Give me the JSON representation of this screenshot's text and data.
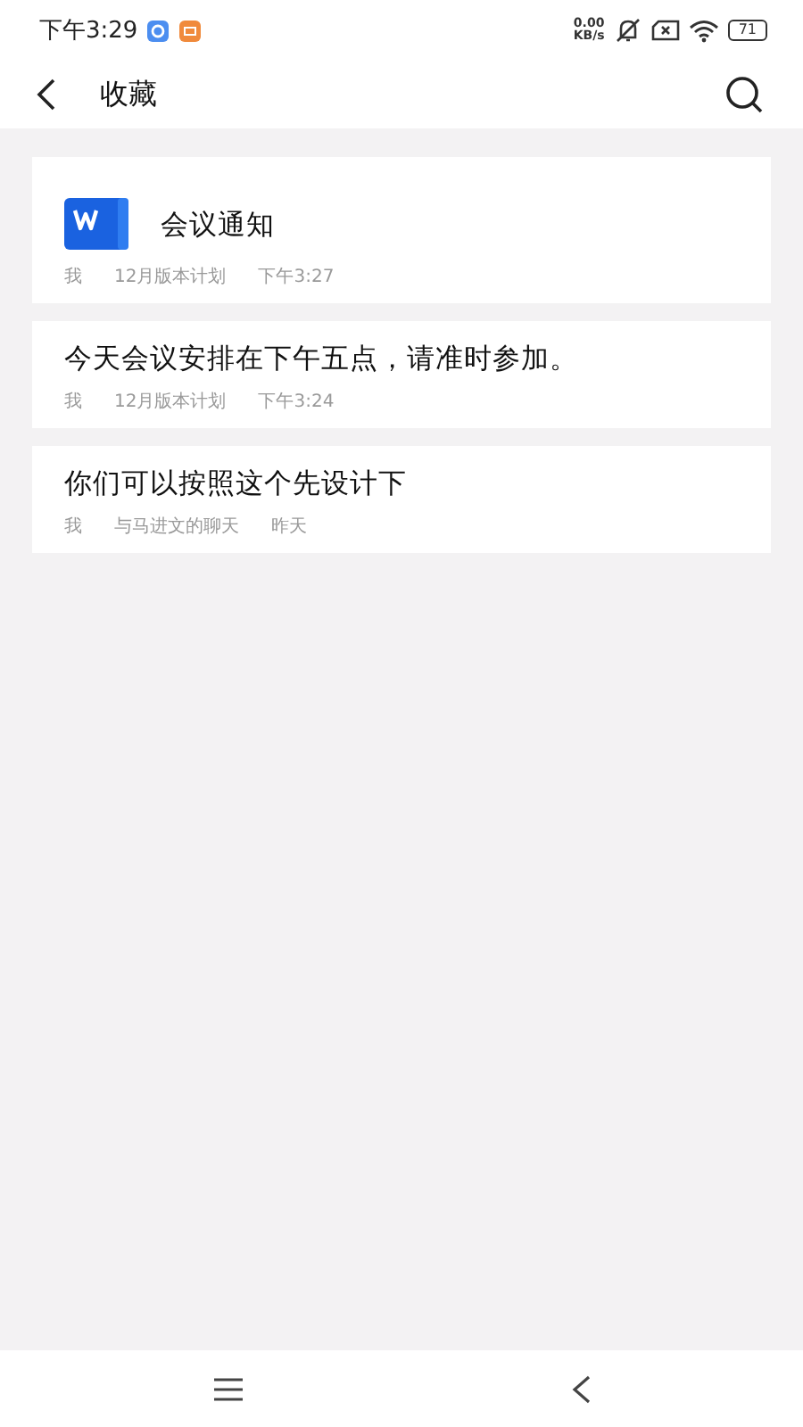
{
  "status_bar": {
    "time": "下午3:29",
    "net_speed_value": "0.00",
    "net_speed_unit": "KB/s",
    "battery": "71"
  },
  "header": {
    "title": "收藏"
  },
  "items": [
    {
      "kind": "file",
      "title": "会议通知",
      "sender": "我",
      "source": "12月版本计划",
      "time": "下午3:27"
    },
    {
      "kind": "text",
      "title": "今天会议安排在下午五点，请准时参加。",
      "sender": "我",
      "source": "12月版本计划",
      "time": "下午3:24"
    },
    {
      "kind": "text",
      "title": "你们可以按照这个先设计下",
      "sender": "我",
      "source": "与马进文的聊天",
      "time": "昨天"
    }
  ]
}
